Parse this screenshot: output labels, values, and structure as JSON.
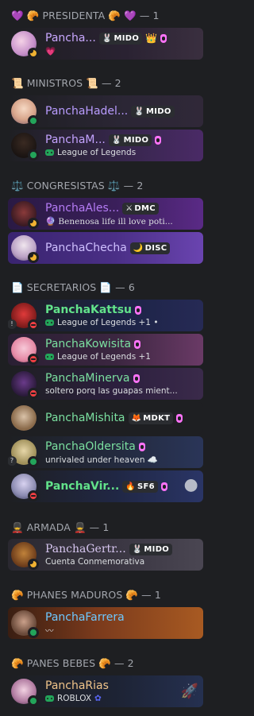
{
  "roles": [
    {
      "key": "presidenta",
      "label": "💜 🥐 PRESIDENTA 🥐 💜 — 1"
    },
    {
      "key": "ministros",
      "label": "📜 MINISTROS 📜 — 2"
    },
    {
      "key": "congresistas",
      "label": "⚖️ CONGRESISTAS ⚖️ — 2"
    },
    {
      "key": "secretarios",
      "label": "📄 SECRETARIOS 📄 — 6"
    },
    {
      "key": "armada",
      "label": "💂 ARMADA 💂 — 1"
    },
    {
      "key": "phanes",
      "label": "🥐 PHANES MADUROS 🥐 — 1"
    },
    {
      "key": "panes",
      "label": "🥐 PANES BEBES 🥐 — 2"
    }
  ],
  "members": [
    {
      "name": "Pancha...",
      "tag": "MIDO",
      "tag_icon": "🐰",
      "crown": "👑",
      "sub": "💗",
      "status": "idle",
      "name_color": "#c9a8ff",
      "bg": "#2a2232"
    },
    {
      "name": "PanchaHadel...",
      "tag": "MIDO",
      "tag_icon": "🐰",
      "status": "online",
      "name_color": "#b99cff",
      "bg": "#2b2635"
    },
    {
      "name": "PanchaM...",
      "tag": "MIDO",
      "tag_icon": "🐰",
      "sub": "League of Legends",
      "status": "online",
      "name_color": "#c4a3ff",
      "bg": "#35264a"
    },
    {
      "name": "PanchaAles...",
      "tag": "DMC",
      "tag_icon": "⚔",
      "sub": "🔮 Benenosa life ill love poti...",
      "status": "idle",
      "name_color": "#b57cf5",
      "bg": "#3a1f5a"
    },
    {
      "name": "PanchaChecha",
      "tag": "DISC",
      "tag_icon": "🌙",
      "status": "idle",
      "name_color": "#cfc0ff",
      "bg": "#4a2f86"
    },
    {
      "name": "PanchaKattsu",
      "sub": "League of Legends +1 •",
      "status": "dnd",
      "name_color": "#62e28a",
      "bg": "#1c2345"
    },
    {
      "name": "PanchaKowisita",
      "sub": "League of Legends +1",
      "status": "dnd",
      "name_color": "#7be0a0",
      "bg": "#3b2640"
    },
    {
      "name": "PanchaMinerva",
      "sub": "soltero porq las guapas mient...",
      "status": "dnd",
      "name_color": "#7be0a0",
      "bg": "#2c1f3e"
    },
    {
      "name": "PanchaMishita",
      "tag": "MDKT",
      "tag_icon": "🦊",
      "status": "none",
      "name_color": "#7be0a0",
      "bg": "#1e1f22"
    },
    {
      "name": "PanchaOldersita",
      "sub": "unrivaled under heaven ☁️",
      "status": "online",
      "name_color": "#7be0a0",
      "bg": "#232a3e"
    },
    {
      "name": "PanchaVir...",
      "tag": "SF6",
      "tag_icon": "🔥",
      "status": "dnd",
      "name_color": "#62e28a",
      "bg": "#202744"
    },
    {
      "name": "PanchaGertr...",
      "tag": "MIDO",
      "tag_icon": "🐰",
      "sub": "Cuenta Conmemorativa",
      "status": "idle",
      "name_color": "#d7c6f0",
      "bg": "#3a3642"
    },
    {
      "name": "PanchaFarrera",
      "sub": "〰",
      "status": "online",
      "name_color": "#6ec8ff",
      "bg": "#7a3a1c"
    },
    {
      "name": "PanchaRias",
      "sub": "ROBLOX",
      "status": "online",
      "name_color": "#f0c48a",
      "bg": "#1d2334"
    }
  ]
}
